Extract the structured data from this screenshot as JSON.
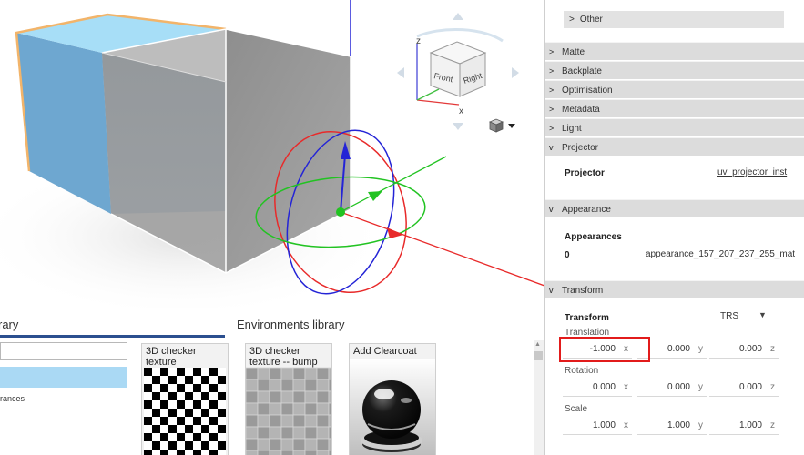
{
  "viewcube": {
    "front_label": "Front",
    "right_label": "Right",
    "z_label": "z",
    "x_label": "x",
    "display_menu_icon": "shaded-cube-icon"
  },
  "library": {
    "tabs": [
      {
        "label": "rary"
      },
      {
        "label": "Environments library"
      }
    ],
    "search_value": "",
    "tree_item": "rances",
    "tiles": [
      {
        "label": "3D checker texture",
        "preview": "checkerboard"
      },
      {
        "label": "3D checker texture -- bump",
        "preview": "bump-checker"
      },
      {
        "label": "Add Clearcoat",
        "preview": "glossy-black-sphere"
      }
    ]
  },
  "panel": {
    "other_label": "Other",
    "sections": {
      "matte": "Matte",
      "backplate": "Backplate",
      "optimisation": "Optimisation",
      "metadata": "Metadata",
      "light": "Light",
      "projector": "Projector",
      "appearance": "Appearance",
      "transform": "Transform"
    },
    "projector": {
      "label": "Projector",
      "value": "uv_projector_inst"
    },
    "appearance": {
      "label": "Appearances",
      "index": "0",
      "value": "appearance_157_207_237_255_mat"
    },
    "transform": {
      "label": "Transform",
      "mode": "TRS",
      "translation": {
        "label": "Translation",
        "x": "-1.000",
        "y": "0.000",
        "z": "0.000"
      },
      "rotation": {
        "label": "Rotation",
        "x": "0.000",
        "y": "0.000",
        "z": "0.000"
      },
      "scale": {
        "label": "Scale",
        "x": "1.000",
        "y": "1.000",
        "z": "1.000"
      },
      "axis_labels": {
        "x": "x",
        "y": "y",
        "z": "z"
      }
    }
  },
  "colors": {
    "cube_top": "#a7def7",
    "cube_side": "#6ea7d0",
    "selection_outline": "#f2b46a",
    "gizmo_x": "#e82a2a",
    "gizmo_y": "#22c322",
    "gizmo_z": "#2424d6",
    "section_header": "#dcdcdc",
    "highlight": "#e21b1b",
    "library_tab_underline": "#2b4f8f"
  }
}
